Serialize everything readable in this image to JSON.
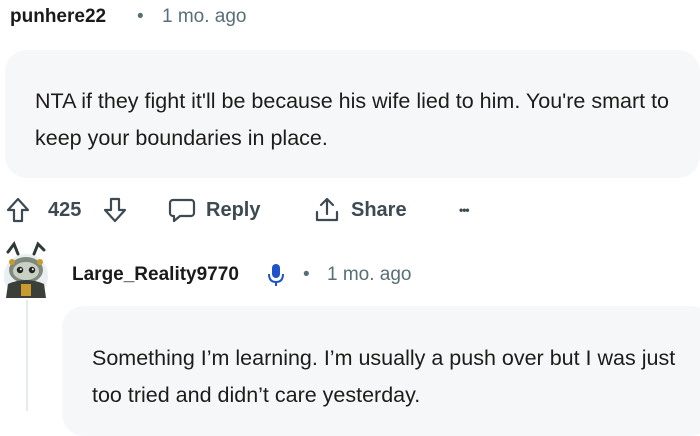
{
  "comment1": {
    "author": "punhere22",
    "separator": "•",
    "time": "1 mo. ago",
    "body": "NTA if they fight it'll be because his wife lied to him. You're smart to keep your boundaries in place.",
    "score": "425",
    "reply_label": "Reply",
    "share_label": "Share",
    "more_label": "•••"
  },
  "comment2": {
    "author": "Large_Reality9770",
    "separator": "•",
    "time": "1 mo. ago",
    "body": "Something I’m learning. I’m usually a push over but I was just too tried and didn’t care yesterday."
  },
  "icons": {
    "upvote": "arrow-up-outline",
    "downvote": "arrow-down-outline",
    "reply": "speech-bubble-outline",
    "share": "share-arrow-outline",
    "more": "horizontal-ellipsis",
    "mic": "microphone",
    "avatar": "snoo-avatar"
  },
  "colors": {
    "text": "#1c1c1c",
    "meta": "#576f76",
    "bubble": "#f6f7f8",
    "mic_blue": "#1f54c9"
  }
}
